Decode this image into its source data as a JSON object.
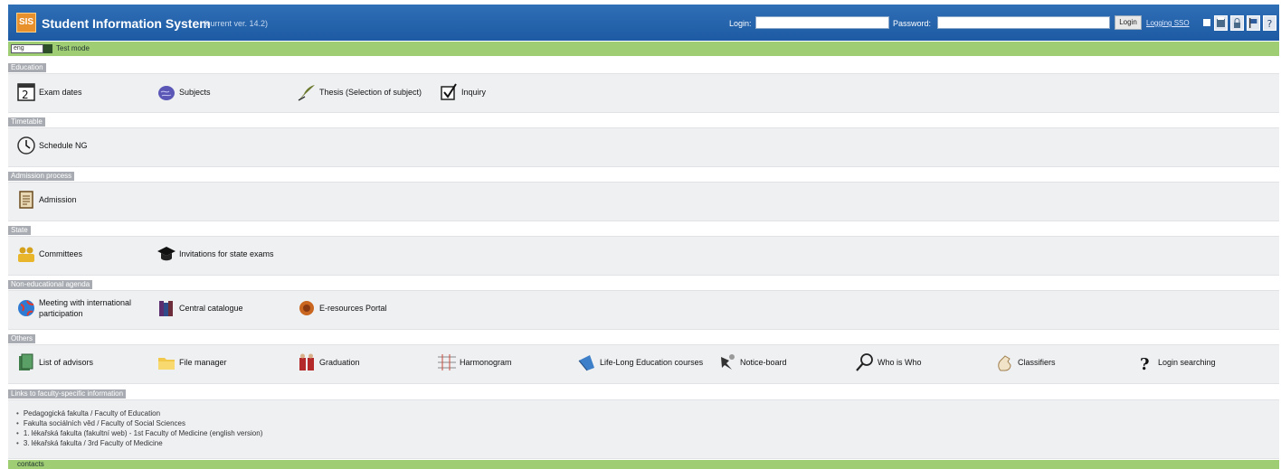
{
  "header": {
    "logo_text": "SIS",
    "title": "Student Information System",
    "version": "(current ver. 14.2)",
    "login_label": "Login:",
    "password_label": "Password:",
    "login_value": "",
    "password_value": "",
    "login_button": "Login",
    "access_link": "Logging SSO",
    "icons": [
      "mail-icon",
      "printer-icon",
      "lock-icon",
      "flag-icon",
      "help-icon"
    ]
  },
  "mode_bar": {
    "select_value": "eng",
    "text": "Test mode"
  },
  "sections": [
    {
      "title": "Education",
      "items": [
        {
          "label": "Exam dates",
          "icon": "calendar-icon"
        },
        {
          "label": "Subjects",
          "icon": "brain-icon"
        },
        {
          "label": "Thesis (Selection of subject)",
          "icon": "quill-icon"
        },
        {
          "label": "Inquiry",
          "icon": "checkbox-icon"
        }
      ]
    },
    {
      "title": "Timetable",
      "items": [
        {
          "label": "Schedule NG",
          "icon": "clock-icon"
        }
      ]
    },
    {
      "title": "Admission process",
      "items": [
        {
          "label": "Admission",
          "icon": "document-icon"
        }
      ]
    },
    {
      "title": "State",
      "items": [
        {
          "label": "Committees",
          "icon": "people-icon"
        },
        {
          "label": "Invitations for state exams",
          "icon": "graduation-cap-icon"
        }
      ]
    },
    {
      "title": "Non-educational agenda",
      "items": [
        {
          "label": "Meeting with international participation",
          "icon": "globe-icon"
        },
        {
          "label": "Central catalogue",
          "icon": "books-icon"
        },
        {
          "label": "E-resources Portal",
          "icon": "emblem-icon"
        }
      ]
    },
    {
      "title": "Others",
      "items": [
        {
          "label": "List of advisors",
          "icon": "book-stack-icon"
        },
        {
          "label": "File manager",
          "icon": "folder-icon"
        },
        {
          "label": "Graduation",
          "icon": "graduate-icon"
        },
        {
          "label": "Harmonogram",
          "icon": "timeline-icon"
        },
        {
          "label": "Life-Long Education courses",
          "icon": "bird-icon"
        },
        {
          "label": "Notice-board",
          "icon": "pin-icon"
        },
        {
          "label": "Who is Who",
          "icon": "magnifier-icon"
        },
        {
          "label": "Classifiers",
          "icon": "hand-icon"
        },
        {
          "label": "Login searching",
          "icon": "question-icon"
        }
      ]
    },
    {
      "title": "Links to faculty-specific information",
      "links": [
        "Pedagogická fakulta / Faculty of Education",
        "Fakulta sociálních věd / Faculty of Social Sciences",
        "1. lékařská fakulta (fakultní web) - 1st Faculty of Medicine (english version)",
        "3. lékařská fakulta / 3rd Faculty of Medicine"
      ]
    }
  ],
  "footer": {
    "text": "contacts"
  }
}
